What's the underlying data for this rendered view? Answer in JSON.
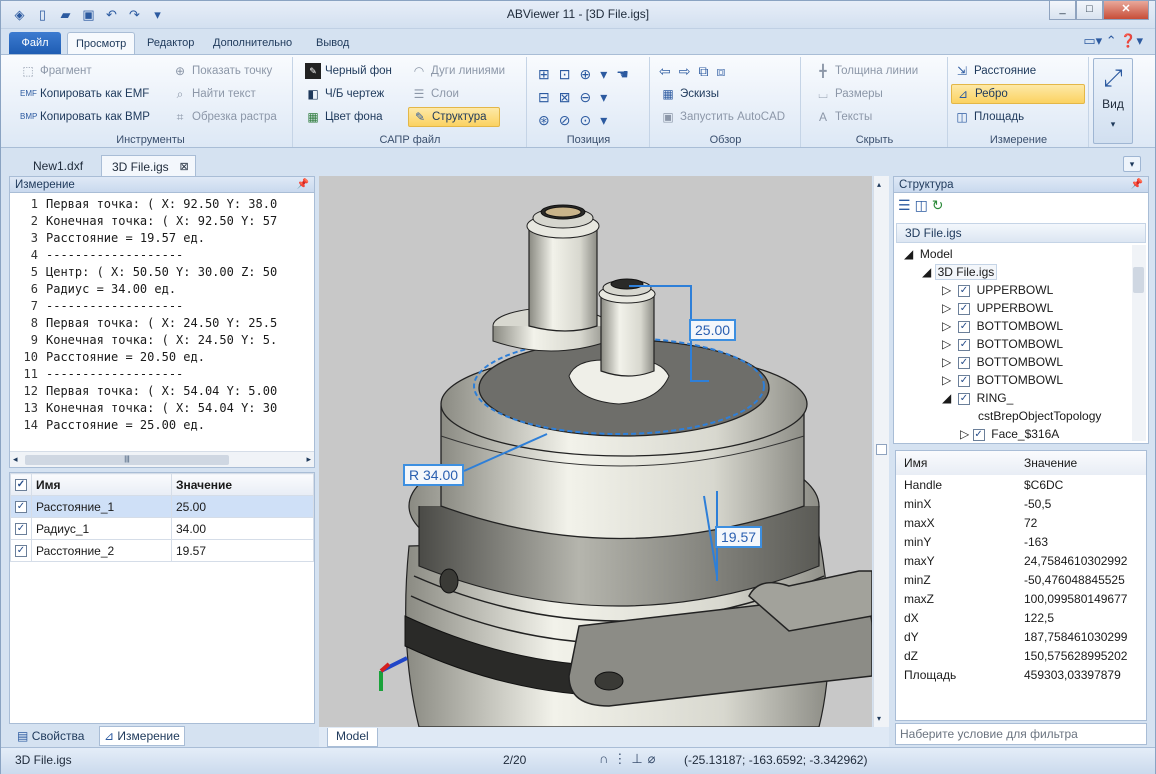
{
  "window": {
    "title": "ABViewer 11 - [3D File.igs]",
    "qat_icons": [
      "app-icon",
      "new-icon",
      "open-icon",
      "save-icon",
      "undo-icon",
      "redo-icon"
    ],
    "controls": [
      "_",
      "□",
      "✕"
    ]
  },
  "ribbon_tabs": [
    {
      "label": "Файл"
    },
    {
      "label": "Просмотр"
    },
    {
      "label": "Редактор"
    },
    {
      "label": "Дополнительно"
    },
    {
      "label": "Вывод"
    }
  ],
  "groups": {
    "instruments": {
      "label": "Инструменты",
      "items": [
        "Фрагмент",
        "Копировать как EMF",
        "Копировать как BMP",
        "Показать точку",
        "Найти текст",
        "Обрезка растра"
      ]
    },
    "cad": {
      "label": "САПР файл",
      "items": [
        "Черный фон",
        "Ч/Б чертеж",
        "Цвет фона",
        "Дуги линиями",
        "Слои",
        "Структура"
      ]
    },
    "position": {
      "label": "Позиция"
    },
    "overview": {
      "label": "Обзор",
      "items": [
        "Эскизы",
        "Запустить AutoCAD"
      ]
    },
    "hide": {
      "label": "Скрыть",
      "items": [
        "Толщина линии",
        "Размеры",
        "Тексты"
      ]
    },
    "measure": {
      "label": "Измерение",
      "items": [
        "Расстояние",
        "Ребро",
        "Площадь"
      ]
    },
    "view": {
      "label": "Вид"
    }
  },
  "doc_tabs": [
    "New1.dxf",
    "3D File.igs"
  ],
  "measure_panel": {
    "title": "Измерение",
    "lines": [
      {
        "n": "1",
        "text": "Первая точка: ( X: 92.50 Y: 38.0"
      },
      {
        "n": "2",
        "text": "Конечная точка: ( X: 92.50 Y: 57"
      },
      {
        "n": "3",
        "text": "Расстояние = 19.57 ед."
      },
      {
        "n": "4",
        "text": "-------------------"
      },
      {
        "n": "5",
        "text": "Центр: ( X: 50.50 Y: 30.00 Z: 50"
      },
      {
        "n": "6",
        "text": "Радиус = 34.00 ед."
      },
      {
        "n": "7",
        "text": "-------------------"
      },
      {
        "n": "8",
        "text": "Первая точка: ( X: 24.50 Y: 25.5"
      },
      {
        "n": "9",
        "text": "Конечная точка: ( X: 24.50 Y: 5."
      },
      {
        "n": "10",
        "text": "Расстояние = 20.50 ед."
      },
      {
        "n": "11",
        "text": "-------------------"
      },
      {
        "n": "12",
        "text": "Первая точка: ( X: 54.04 Y: 5.00"
      },
      {
        "n": "13",
        "text": "Конечная точка: ( X: 54.04 Y: 30"
      },
      {
        "n": "14",
        "text": "Расстояние = 25.00 ед."
      }
    ],
    "table": {
      "headers": [
        "Имя",
        "Значение"
      ],
      "rows": [
        {
          "name": "Расстояние_1",
          "value": "25.00"
        },
        {
          "name": "Радиус_1",
          "value": "34.00"
        },
        {
          "name": "Расстояние_2",
          "value": "19.57"
        }
      ]
    },
    "bottom_tabs": [
      "Свойства",
      "Измерение"
    ]
  },
  "viewport": {
    "dims": [
      "25.00",
      "R 34.00",
      "19.57"
    ],
    "tab": "Model"
  },
  "structure_panel": {
    "title": "Структура",
    "file_tab": "3D File.igs",
    "tree": [
      "Model",
      "3D File.igs",
      "UPPERBOWL",
      "UPPERBOWL",
      "BOTTOMBOWL",
      "BOTTOMBOWL",
      "BOTTOMBOWL",
      "BOTTOMBOWL",
      "RING_",
      "cstBrepObjectTopology",
      "Face_$316A"
    ],
    "props_headers": [
      "Имя",
      "Значение"
    ],
    "props": [
      {
        "k": "Handle",
        "v": "$C6DC"
      },
      {
        "k": "minX",
        "v": "-50,5"
      },
      {
        "k": "maxX",
        "v": "72"
      },
      {
        "k": "minY",
        "v": "-163"
      },
      {
        "k": "maxY",
        "v": "24,7584610302992"
      },
      {
        "k": "minZ",
        "v": "-50,476048845525"
      },
      {
        "k": "maxZ",
        "v": "100,099580149677"
      },
      {
        "k": "dX",
        "v": "122,5"
      },
      {
        "k": "dY",
        "v": "187,758461030299"
      },
      {
        "k": "dZ",
        "v": "150,575628995202"
      },
      {
        "k": "Площадь",
        "v": "459303,03397879"
      }
    ],
    "filter_placeholder": "Наберите условие для фильтра"
  },
  "status": {
    "file": "3D File.igs",
    "pages": "2/20",
    "coords": "(-25.13187; -163.6592; -3.342962)"
  }
}
